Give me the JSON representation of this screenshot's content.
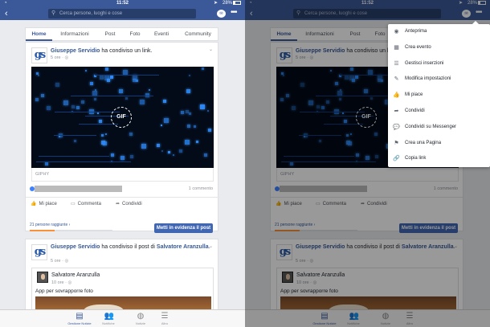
{
  "status": {
    "time": "11:52",
    "battery": "28%"
  },
  "nav": {
    "search_placeholder": "Cerca persone, luoghi e cose"
  },
  "tabs": [
    "Home",
    "Informazioni",
    "Post",
    "Foto",
    "Eventi",
    "Community"
  ],
  "post1": {
    "author": "Giuseppe Servidio",
    "action": " ha condiviso un link.",
    "time": "5 ore · ",
    "gif_label": "GIF",
    "source": "GIPHY",
    "comments": "1 commento",
    "reach": "21 persone raggiunte ›",
    "boost": "Metti in evidenza il post"
  },
  "actions": {
    "like": "Mi piace",
    "comment": "Commenta",
    "share": "Condividi"
  },
  "post2": {
    "author": "Giuseppe Servidio",
    "action": " ha condiviso il post di ",
    "shared_author": "Salvatore Aranzulla",
    "dot": ".",
    "time": "5 ore · ",
    "inner_author": "Salvatore Aranzulla",
    "inner_time": "10 ore · ",
    "inner_text": "App per sovrapporre foto"
  },
  "bottom_tabs": [
    "Gestione Notizie",
    "Notifiche",
    "Notizie",
    "Altro"
  ],
  "menu": {
    "items": [
      {
        "icon": "eye-icon",
        "glyph": "◉",
        "label": "Anteprima"
      },
      {
        "icon": "calendar-icon",
        "glyph": "▦",
        "label": "Crea evento"
      },
      {
        "icon": "list-icon",
        "glyph": "☰",
        "label": "Gestisci inserzioni"
      },
      {
        "icon": "pencil-icon",
        "glyph": "✎",
        "label": "Modifica impostazioni"
      },
      {
        "icon": "thumbs-up-icon",
        "glyph": "👍",
        "label": "Mi piace"
      },
      {
        "icon": "share-icon",
        "glyph": "➦",
        "label": "Condividi"
      },
      {
        "icon": "messenger-icon",
        "glyph": "💬",
        "label": "Condividi su Messenger"
      },
      {
        "icon": "flag-icon",
        "glyph": "⚑",
        "label": "Crea una Pagina"
      },
      {
        "icon": "link-icon",
        "glyph": "🔗",
        "label": "Copia link"
      }
    ]
  },
  "colors": {
    "brand": "#3b5998",
    "boost": "#4267b2",
    "reach_fill": "#f7923b"
  },
  "reach_progress": 0.3
}
